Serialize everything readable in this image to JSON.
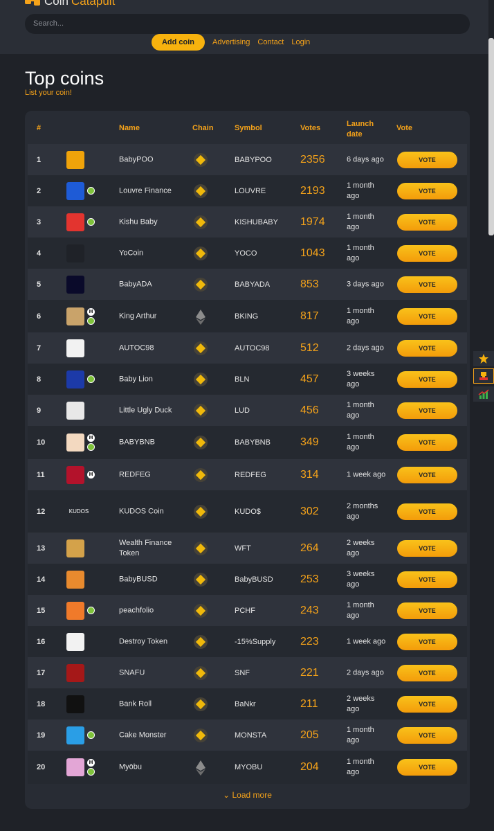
{
  "header": {
    "logo_coin": "Coin",
    "logo_catapult": "Catapult",
    "search_placeholder": "Search...",
    "add_coin": "Add coin",
    "nav": [
      "Advertising",
      "Contact",
      "Login"
    ]
  },
  "page": {
    "title": "Top coins",
    "subtitle": "List your coin!"
  },
  "table": {
    "headers": {
      "rank": "#",
      "name": "Name",
      "chain": "Chain",
      "symbol": "Symbol",
      "votes": "Votes",
      "launch": "Launch date",
      "vote": "Vote"
    },
    "vote_label": "VOTE",
    "rows": [
      {
        "rank": "1",
        "name": "BabyPOO",
        "chain": "bnb",
        "symbol": "BABYPOO",
        "votes": "2356",
        "launch": "6 days ago",
        "avatar_bg": "#f0a30a",
        "badges": []
      },
      {
        "rank": "2",
        "name": "Louvre Finance",
        "chain": "bnb",
        "symbol": "LOUVRE",
        "votes": "2193",
        "launch": "1 month ago",
        "avatar_bg": "#1e5bd6",
        "badges": [
          "green"
        ]
      },
      {
        "rank": "3",
        "name": "Kishu Baby",
        "chain": "bnb",
        "symbol": "KISHUBABY",
        "votes": "1974",
        "launch": "1 month ago",
        "avatar_bg": "#e3342f",
        "badges": [
          "green"
        ]
      },
      {
        "rank": "4",
        "name": "YoCoin",
        "chain": "bnb",
        "symbol": "YOCO",
        "votes": "1043",
        "launch": "1 month ago",
        "avatar_bg": "#1f2228",
        "badges": []
      },
      {
        "rank": "5",
        "name": "BabyADA",
        "chain": "bnb",
        "symbol": "BABYADA",
        "votes": "853",
        "launch": "3 days ago",
        "avatar_bg": "#0a0a2a",
        "badges": []
      },
      {
        "rank": "6",
        "name": "King Arthur",
        "chain": "eth",
        "symbol": "BKING",
        "votes": "817",
        "launch": "1 month ago",
        "avatar_bg": "#c9a36a",
        "badges": [
          "m",
          "green"
        ]
      },
      {
        "rank": "7",
        "name": "AUTOC98",
        "chain": "bnb",
        "symbol": "AUTOC98",
        "votes": "512",
        "launch": "2 days ago",
        "avatar_bg": "#f2f2f2",
        "badges": []
      },
      {
        "rank": "8",
        "name": "Baby Lion",
        "chain": "bnb",
        "symbol": "BLN",
        "votes": "457",
        "launch": "3 weeks ago",
        "avatar_bg": "#1c3aa8",
        "badges": [
          "green"
        ]
      },
      {
        "rank": "9",
        "name": "Little Ugly Duck",
        "chain": "bnb",
        "symbol": "LUD",
        "votes": "456",
        "launch": "1 month ago",
        "avatar_bg": "#e8e8e8",
        "badges": []
      },
      {
        "rank": "10",
        "name": "BABYBNB",
        "chain": "bnb",
        "symbol": "BABYBNB",
        "votes": "349",
        "launch": "1 month ago",
        "avatar_bg": "#f3d9c0",
        "badges": [
          "m",
          "green"
        ]
      },
      {
        "rank": "11",
        "name": "REDFEG",
        "chain": "bnb",
        "symbol": "REDFEG",
        "votes": "314",
        "launch": "1 week ago",
        "avatar_bg": "#b3122b",
        "badges": [
          "m"
        ]
      },
      {
        "rank": "12",
        "name": "KUDOS Coin",
        "chain": "bnb",
        "symbol": "KUDO$",
        "votes": "302",
        "launch": "2 months ago",
        "avatar_bg": "#252930",
        "avatar_text": "KUDOS",
        "badges": []
      },
      {
        "rank": "13",
        "name": "Wealth Finance Token",
        "chain": "bnb",
        "symbol": "WFT",
        "votes": "264",
        "launch": "2 weeks ago",
        "avatar_bg": "#d4a24a",
        "badges": []
      },
      {
        "rank": "14",
        "name": "BabyBUSD",
        "chain": "bnb",
        "symbol": "BabyBUSD",
        "votes": "253",
        "launch": "3 weeks ago",
        "avatar_bg": "#e88a2e",
        "badges": []
      },
      {
        "rank": "15",
        "name": "peachfolio",
        "chain": "bnb",
        "symbol": "PCHF",
        "votes": "243",
        "launch": "1 month ago",
        "avatar_bg": "#f07a2a",
        "badges": [
          "green"
        ]
      },
      {
        "rank": "16",
        "name": "Destroy Token",
        "chain": "bnb",
        "symbol": "-15%Supply",
        "votes": "223",
        "launch": "1 week ago",
        "avatar_bg": "#f2f2f2",
        "badges": []
      },
      {
        "rank": "17",
        "name": "SNAFU",
        "chain": "bnb",
        "symbol": "SNF",
        "votes": "221",
        "launch": "2 days ago",
        "avatar_bg": "#a51818",
        "badges": []
      },
      {
        "rank": "18",
        "name": "Bank Roll",
        "chain": "bnb",
        "symbol": "BaNkr",
        "votes": "211",
        "launch": "2 weeks ago",
        "avatar_bg": "#111111",
        "badges": []
      },
      {
        "rank": "19",
        "name": "Cake Monster",
        "chain": "bnb",
        "symbol": "MONSTA",
        "votes": "205",
        "launch": "1 month ago",
        "avatar_bg": "#2a9ee6",
        "badges": [
          "green"
        ]
      },
      {
        "rank": "20",
        "name": "Myōbu",
        "chain": "eth",
        "symbol": "MYOBU",
        "votes": "204",
        "launch": "1 month ago",
        "avatar_bg": "#e3a6d6",
        "badges": [
          "m",
          "green"
        ]
      }
    ],
    "load_more": "Load more"
  },
  "side_panel": {
    "icons": [
      "star-icon",
      "trophy-icon",
      "chart-icon"
    ],
    "accent": "#f4a21a"
  }
}
